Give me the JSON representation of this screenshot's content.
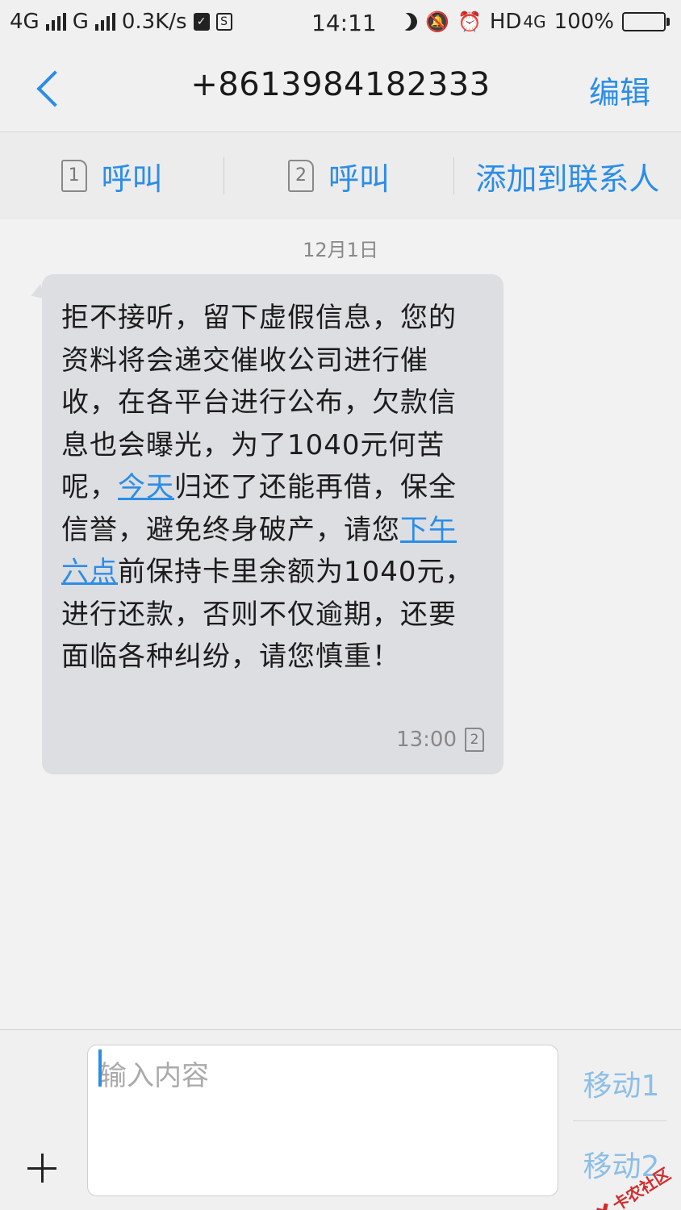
{
  "status_bar": {
    "network1": "4G",
    "network2": "G",
    "speed": "0.3K/s",
    "time": "14:11",
    "hd": "HD",
    "net4g": "4G",
    "battery": "100%"
  },
  "header": {
    "title": "+8613984182333",
    "edit_label": "编辑"
  },
  "actions": {
    "call1_sim": "1",
    "call1_label": "呼叫",
    "call2_sim": "2",
    "call2_label": "呼叫",
    "add_contact_label": "添加到联系人"
  },
  "conversation": {
    "date": "12月1日",
    "message": {
      "part1": "拒不接听，留下虚假信息，您的资料将会递交催收公司进行催收，在各平台进行公布，欠款信息也会曝光，为了1040元何苦呢，",
      "link1": "今天",
      "part2": "归还了还能再借，保全信誉，避免终身破产，请您",
      "link2": "下午六点",
      "part3": "前保持卡里余额为1040元，进行还款，否则不仅逾期，还要面临各种纠纷，请您慎重！",
      "time": "13:00",
      "sim": "2"
    }
  },
  "compose": {
    "placeholder": "输入内容",
    "send1_label": "移动1",
    "send2_label": "移动2"
  },
  "watermark": {
    "text": "卡农社区"
  },
  "colors": {
    "accent": "#2b8de8",
    "bubble": "#dcdee2",
    "watermark": "#d42a2a"
  }
}
